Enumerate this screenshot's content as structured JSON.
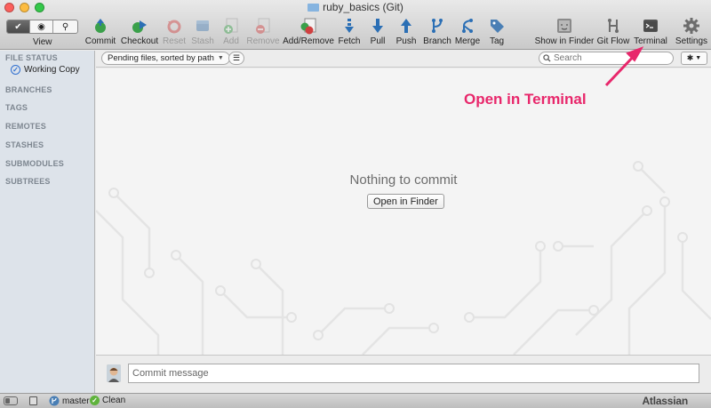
{
  "window": {
    "title": "ruby_basics (Git)"
  },
  "toolbar": {
    "view_label": "View",
    "buttons": [
      {
        "label": "Commit",
        "icon": "commit-icon",
        "enabled": true
      },
      {
        "label": "Checkout",
        "icon": "checkout-icon",
        "enabled": true
      },
      {
        "label": "Reset",
        "icon": "reset-icon",
        "enabled": false
      },
      {
        "label": "Stash",
        "icon": "stash-icon",
        "enabled": false
      },
      {
        "label": "Add",
        "icon": "add-icon",
        "enabled": false
      },
      {
        "label": "Remove",
        "icon": "remove-icon",
        "enabled": false
      },
      {
        "label": "Add/Remove",
        "icon": "add-remove-icon",
        "enabled": true
      },
      {
        "label": "Fetch",
        "icon": "fetch-icon",
        "enabled": true
      },
      {
        "label": "Pull",
        "icon": "pull-icon",
        "enabled": true
      },
      {
        "label": "Push",
        "icon": "push-icon",
        "enabled": true
      },
      {
        "label": "Branch",
        "icon": "branch-icon",
        "enabled": true
      },
      {
        "label": "Merge",
        "icon": "merge-icon",
        "enabled": true
      },
      {
        "label": "Tag",
        "icon": "tag-icon",
        "enabled": true
      },
      {
        "label": "Show in Finder",
        "icon": "finder-icon",
        "enabled": true
      },
      {
        "label": "Git Flow",
        "icon": "git-flow-icon",
        "enabled": true
      },
      {
        "label": "Terminal",
        "icon": "terminal-icon",
        "enabled": true
      },
      {
        "label": "Settings",
        "icon": "settings-icon",
        "enabled": true
      }
    ]
  },
  "annotation": {
    "text": "Open in Terminal",
    "color": "#e8276b"
  },
  "sidebar": {
    "file_status": "FILE STATUS",
    "working_copy": "Working Copy",
    "branches": "BRANCHES",
    "tags": "TAGS",
    "remotes": "REMOTES",
    "stashes": "STASHES",
    "submodules": "SUBMODULES",
    "subtrees": "SUBTREES"
  },
  "filterbar": {
    "sort_select": "Pending files, sorted by path",
    "search_placeholder": "Search"
  },
  "main": {
    "empty_message": "Nothing to commit",
    "open_finder_button": "Open in Finder"
  },
  "commit": {
    "placeholder": "Commit message"
  },
  "statusbar": {
    "branch": "master",
    "status": "Clean",
    "brand": "Atlassian"
  }
}
